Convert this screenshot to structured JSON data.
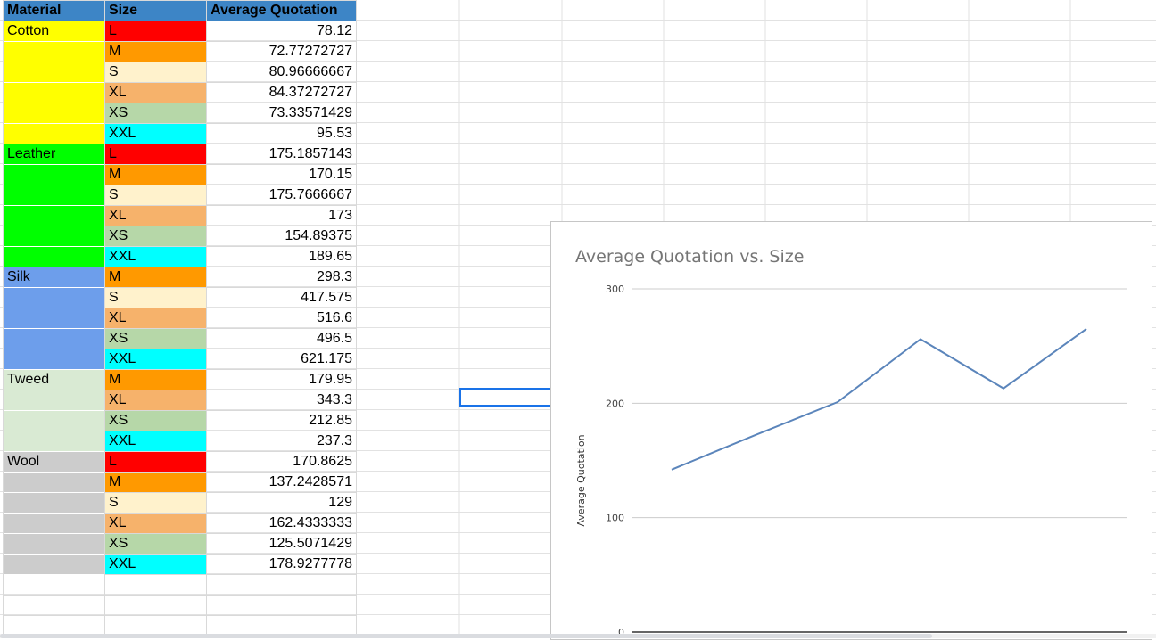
{
  "table": {
    "headers": [
      "Material",
      "Size",
      "Average Quotation"
    ],
    "header_color": "#3d85c6",
    "rows": [
      {
        "material": "Cotton",
        "size": "L",
        "avg": "78.12"
      },
      {
        "material": "",
        "size": "M",
        "avg": "72.77272727"
      },
      {
        "material": "",
        "size": "S",
        "avg": "80.96666667"
      },
      {
        "material": "",
        "size": "XL",
        "avg": "84.37272727"
      },
      {
        "material": "",
        "size": "XS",
        "avg": "73.33571429"
      },
      {
        "material": "",
        "size": "XXL",
        "avg": "95.53"
      },
      {
        "material": "Leather",
        "size": "L",
        "avg": "175.1857143"
      },
      {
        "material": "",
        "size": "M",
        "avg": "170.15"
      },
      {
        "material": "",
        "size": "S",
        "avg": "175.7666667"
      },
      {
        "material": "",
        "size": "XL",
        "avg": "173"
      },
      {
        "material": "",
        "size": "XS",
        "avg": "154.89375"
      },
      {
        "material": "",
        "size": "XXL",
        "avg": "189.65"
      },
      {
        "material": "Silk",
        "size": "M",
        "avg": "298.3"
      },
      {
        "material": "",
        "size": "S",
        "avg": "417.575"
      },
      {
        "material": "",
        "size": "XL",
        "avg": "516.6"
      },
      {
        "material": "",
        "size": "XS",
        "avg": "496.5"
      },
      {
        "material": "",
        "size": "XXL",
        "avg": "621.175"
      },
      {
        "material": "Tweed",
        "size": "M",
        "avg": "179.95"
      },
      {
        "material": "",
        "size": "XL",
        "avg": "343.3"
      },
      {
        "material": "",
        "size": "XS",
        "avg": "212.85"
      },
      {
        "material": "",
        "size": "XXL",
        "avg": "237.3"
      },
      {
        "material": "Wool",
        "size": "L",
        "avg": "170.8625"
      },
      {
        "material": "",
        "size": "M",
        "avg": "137.2428571"
      },
      {
        "material": "",
        "size": "S",
        "avg": "129"
      },
      {
        "material": "",
        "size": "XL",
        "avg": "162.4333333"
      },
      {
        "material": "",
        "size": "XS",
        "avg": "125.5071429"
      },
      {
        "material": "",
        "size": "XXL",
        "avg": "178.9277778"
      }
    ],
    "material_colors": {
      "Cotton": "#ffff00",
      "Leather": "#00ff00",
      "Silk": "#6d9eeb",
      "Tweed": "#d9ead3",
      "Wool": "#cccccc"
    },
    "size_colors": {
      "L": "#ff0000",
      "M": "#ff9900",
      "S": "#fff2cc",
      "XL": "#f6b26b",
      "XS": "#b6d7a8",
      "XXL": "#00ffff"
    }
  },
  "chart_data": {
    "type": "line",
    "title": "Average Quotation vs. Size",
    "xlabel": "",
    "ylabel": "Average Quotation",
    "ylim": [
      0,
      300
    ],
    "y_ticks": [
      "0",
      "100",
      "200",
      "300"
    ],
    "series": [
      {
        "values": [
          142,
          172,
          201,
          256,
          213,
          265
        ],
        "color": "#5b85bb"
      }
    ],
    "grid": true,
    "legend": "none"
  }
}
